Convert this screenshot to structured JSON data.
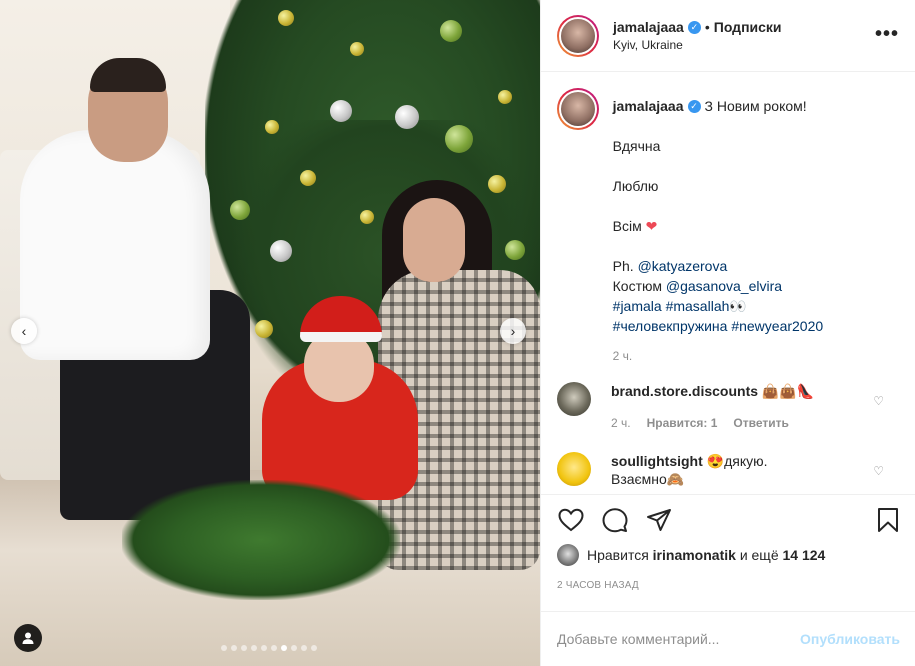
{
  "header": {
    "username": "jamalajaaa",
    "separator": "•",
    "follow_label": "Подписки",
    "location": "Kyiv, Ukraine",
    "more_label": "•••"
  },
  "caption": {
    "username": "jamalajaaa",
    "first_line": "З Новим роком!",
    "line_thanks": "Вдячна",
    "line_love": "Люблю",
    "line_all": "Всім",
    "heart_emoji": "❤",
    "ph_prefix": "Ph.",
    "ph_mention": "@katyazerova",
    "costume_prefix": "Костюм",
    "costume_mention": "@gasanova_elvira",
    "hashtags_line1": "#jamala #masallah👀",
    "hashtags_line2": "#человекпружина #newyear2020",
    "time": "2 ч."
  },
  "comments": [
    {
      "username": "brand.store.discounts",
      "text": "👜👜👠",
      "time": "2 ч.",
      "likes": "Нравится: 1",
      "reply": "Ответить"
    },
    {
      "username": "soullightsight",
      "text": "😍дякую.",
      "text2": "Взаємно🙈"
    }
  ],
  "likes": {
    "prefix": "Нравится",
    "user": "irinamonatik",
    "middle": "и ещё",
    "count": "14 124"
  },
  "timestamp": "2 ЧАСОВ НАЗАД",
  "add_comment": {
    "placeholder": "Добавьте комментарий...",
    "publish_label": "Опубликовать"
  },
  "carousel": {
    "prev": "‹",
    "next": "›",
    "slide_count": 10,
    "active_slide": 6
  },
  "colors": {
    "accent_blue": "#3897f0",
    "link": "#003569",
    "publish_disabled": "#b2dffc",
    "muted": "#8e8e8e"
  }
}
